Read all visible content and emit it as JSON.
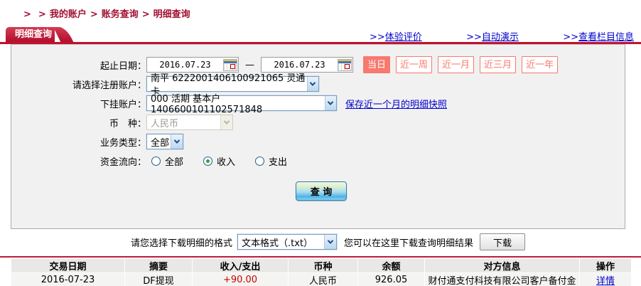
{
  "colors": {
    "accent_red": "#BE1231",
    "breadcrumb_red": "#A21031",
    "salmon": "#F8796F",
    "link_blue": "#0000CC",
    "amount_red": "#CC0000",
    "panel_bg": "#F2F1F1"
  },
  "breadcrumb": {
    "sep": ">",
    "items": [
      "我的账户",
      "账务查询",
      "明细查询"
    ]
  },
  "tab": {
    "label": "明细查询"
  },
  "toplinks": [
    {
      "prefix": ">>",
      "label": "体验评价"
    },
    {
      "prefix": ">>",
      "label": "自动演示"
    },
    {
      "prefix": ">>",
      "label": "查看栏目信息"
    }
  ],
  "form": {
    "date": {
      "label": "起止日期：",
      "from": "2016.07.23",
      "to": "2016.07.23",
      "separator": "—"
    },
    "quick_buttons": [
      {
        "label": "当日",
        "active": true
      },
      {
        "label": "近一周",
        "active": false
      },
      {
        "label": "近一月",
        "active": false
      },
      {
        "label": "近三月",
        "active": false
      },
      {
        "label": "近一年",
        "active": false
      }
    ],
    "register_account": {
      "label": "请选择注册账户：",
      "value": "南平 6222001406100921065 灵通卡"
    },
    "sub_account": {
      "label": "下挂账户：",
      "value": "000 活期 基本户 1406600101102571848",
      "link": "保存近一个月的明细快照"
    },
    "currency": {
      "label": "币　种：",
      "value": "人民币",
      "disabled": true
    },
    "business_type": {
      "label": "业务类型：",
      "value": "全部"
    },
    "fund_flow": {
      "label": "资金流向：",
      "options": [
        {
          "label": "全部",
          "selected": false
        },
        {
          "label": "收入",
          "selected": true
        },
        {
          "label": "支出",
          "selected": false
        }
      ]
    },
    "query_button": "查 询"
  },
  "download": {
    "format_label": "请您选择下载明细的格式",
    "format_value": "文本格式（.txt）",
    "hint": "您可以在这里下载查询明细结果",
    "button": "下载"
  },
  "table": {
    "headers": [
      "交易日期",
      "摘要",
      "收入/支出",
      "币种",
      "余额",
      "对方信息",
      "操作"
    ],
    "rows": [
      {
        "date": "2016-07-23",
        "summary": "DF提现",
        "amount": "+90.00",
        "currency": "人民币",
        "balance": "926.05",
        "counterparty": "财付通支付科技有限公司客户备付金",
        "action": "详情"
      }
    ]
  }
}
